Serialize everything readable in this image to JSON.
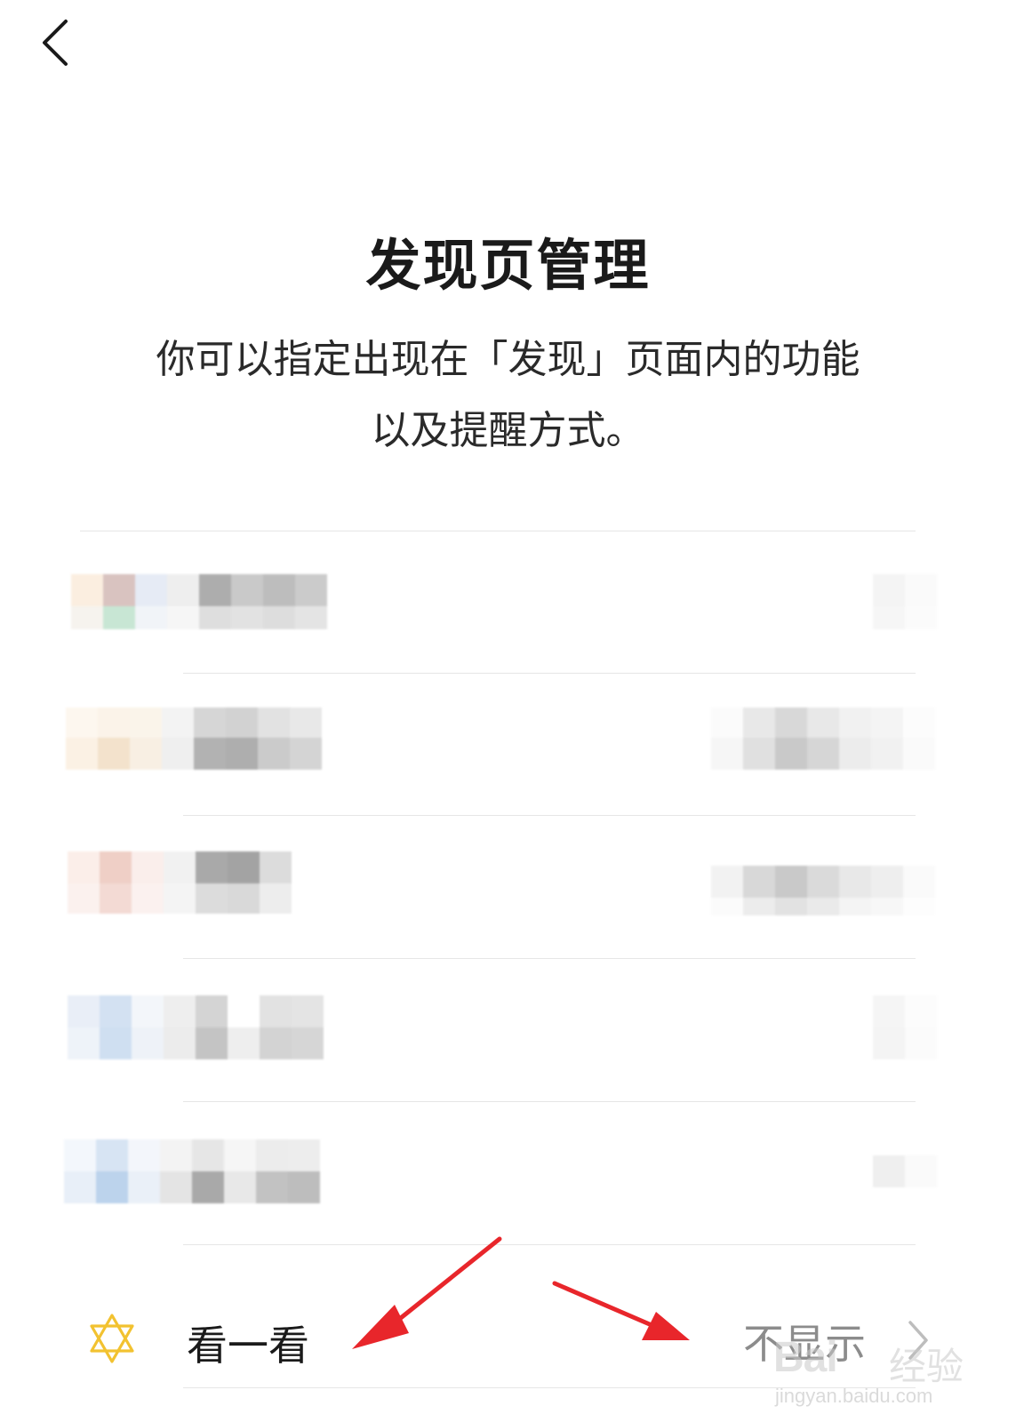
{
  "header": {
    "back_icon": "chevron-left-icon"
  },
  "title": "发现页管理",
  "description": {
    "line1": "你可以指定出现在「发现」页面内的功能",
    "line2": "以及提醒方式。"
  },
  "rows": [
    {
      "label": "",
      "value": "",
      "obscured": true
    },
    {
      "label": "",
      "value": "",
      "obscured": true
    },
    {
      "label": "",
      "value": "",
      "obscured": true
    },
    {
      "label": "",
      "value": "",
      "obscured": true
    },
    {
      "label": "",
      "value": "",
      "obscured": true
    }
  ],
  "kankan_row": {
    "icon": "star-of-david-icon",
    "label": "看一看",
    "value": "不显示",
    "chevron_icon": "chevron-right-icon"
  },
  "annotations": {
    "arrow_color": "#e8262b"
  },
  "watermark": {
    "logo": "Bai",
    "brand": "经验",
    "url": "jingyan.baidu.com"
  }
}
